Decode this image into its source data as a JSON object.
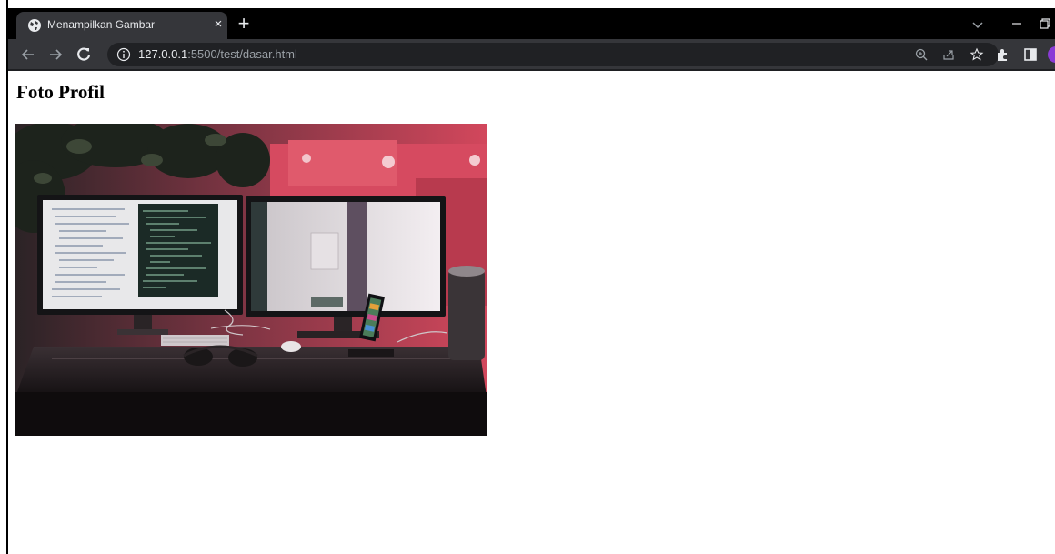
{
  "browser": {
    "tab": {
      "title": "Menampilkan Gambar",
      "close_label": "×"
    },
    "new_tab_label": "+",
    "address": {
      "host": "127.0.0.1",
      "path": ":5500/test/dasar.html"
    }
  },
  "page": {
    "heading": "Foto Profil",
    "image_alt": "Foto Profil"
  }
}
